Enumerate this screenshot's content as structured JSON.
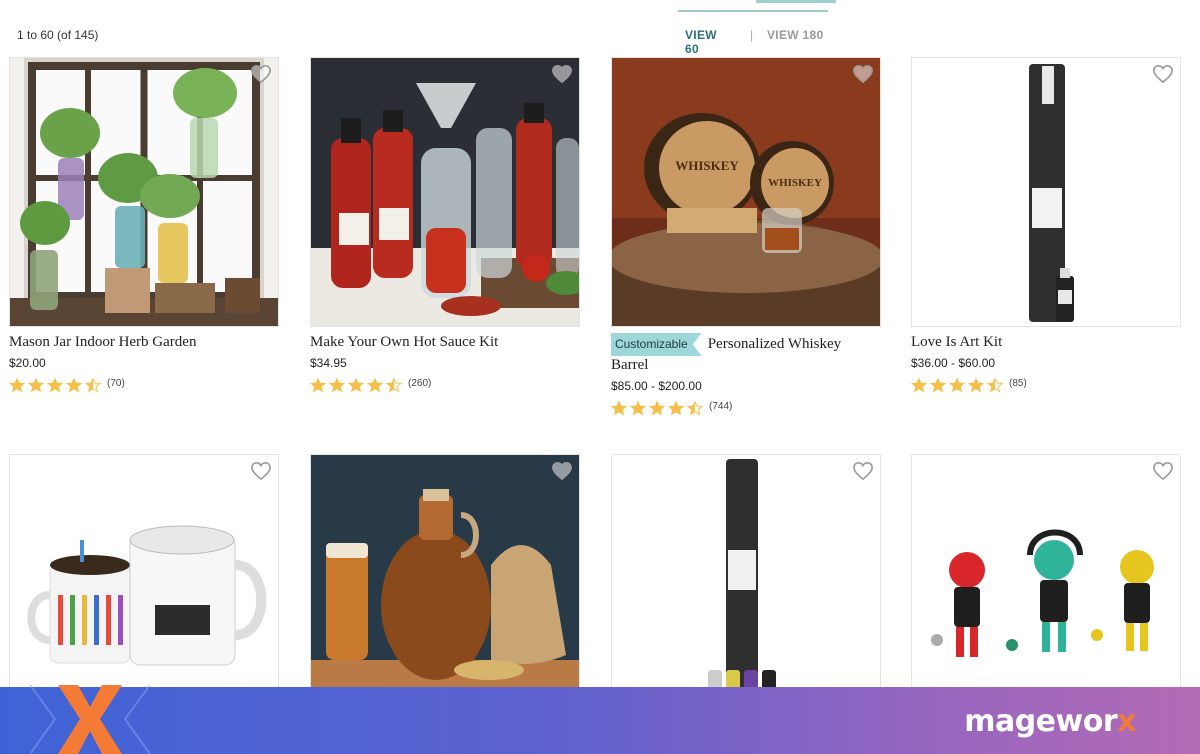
{
  "toolbar": {
    "result_count": "1 to 60 (of 145)",
    "view_60": "VIEW 60",
    "separator": "|",
    "view_180": "VIEW 180"
  },
  "products": [
    {
      "name": "Mason Jar Indoor Herb Garden",
      "price": "$20.00",
      "rating": 4.5,
      "reviews": "(70)",
      "badge": ""
    },
    {
      "name": "Make Your Own Hot Sauce Kit",
      "price": "$34.95",
      "rating": 4.5,
      "reviews": "(260)",
      "badge": ""
    },
    {
      "name": "Personalized Whiskey Barrel",
      "price": "$85.00 - $200.00",
      "rating": 4.5,
      "reviews": "(744)",
      "badge": "Customizable"
    },
    {
      "name": "Love Is Art Kit",
      "price": "$36.00 - $60.00",
      "rating": 4.5,
      "reviews": "(85)",
      "badge": ""
    },
    {
      "name": "",
      "price": "",
      "rating": 0,
      "reviews": "",
      "badge": ""
    },
    {
      "name": "",
      "price": "",
      "rating": 0,
      "reviews": "",
      "badge": ""
    },
    {
      "name": "",
      "price": "",
      "rating": 0,
      "reviews": "",
      "badge": ""
    },
    {
      "name": "",
      "price": "",
      "rating": 0,
      "reviews": "",
      "badge": ""
    }
  ],
  "footer": {
    "brand_main": "magewor",
    "brand_x": "x"
  },
  "colors": {
    "accent": "#2d6f78",
    "star": "#f5c04a",
    "badge": "#9ed7d8",
    "footer_start": "#3f63d6",
    "footer_end": "#b36bb4",
    "brand_x": "#f27a3d"
  },
  "icons": {
    "favorite": "heart-outline-icon",
    "rating": "star-icon",
    "logo": "x-logo-icon"
  }
}
